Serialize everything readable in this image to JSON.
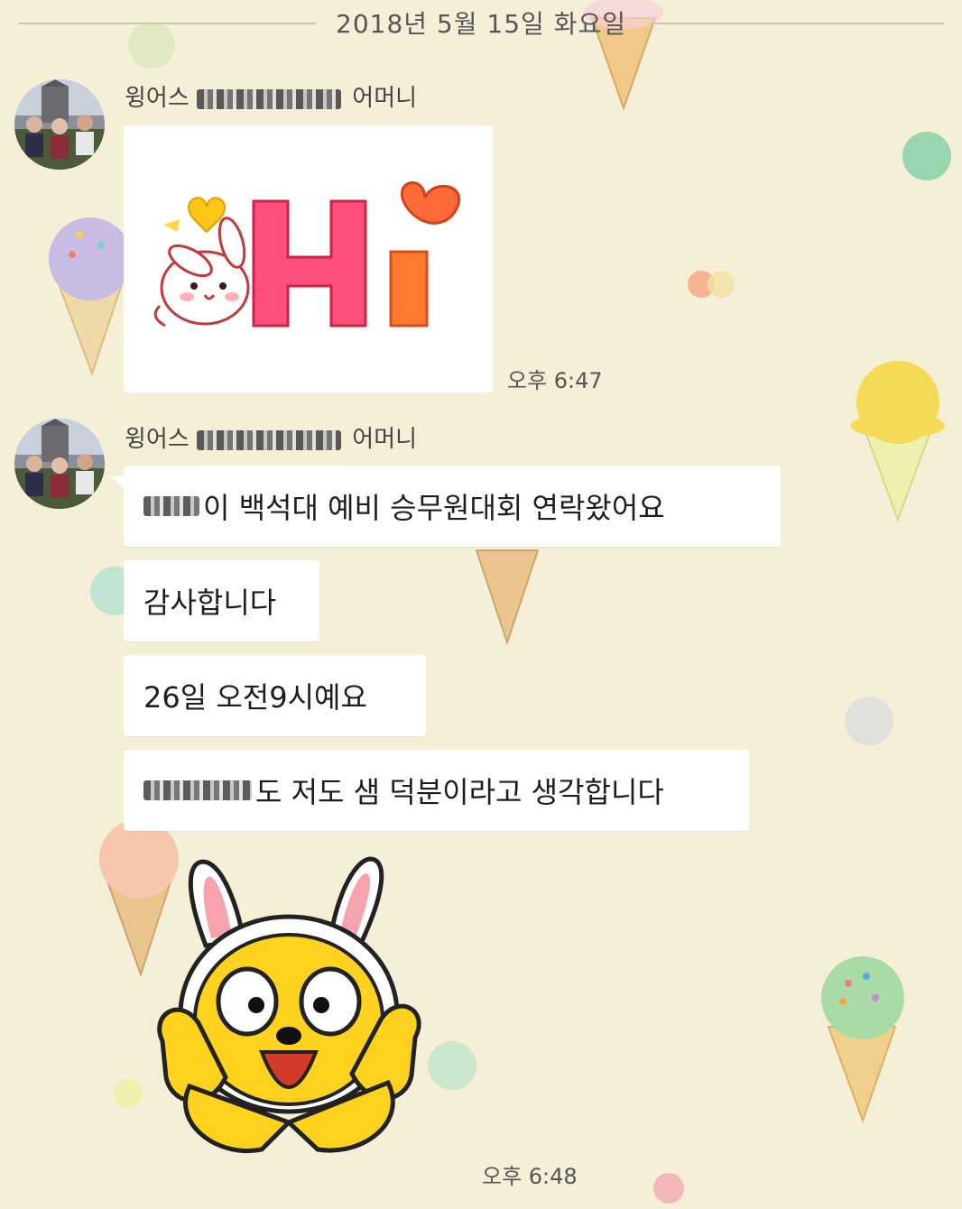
{
  "date_divider": "2018년 5월 15일 화요일",
  "messages": [
    {
      "sender_prefix": "윙어스",
      "sender_suffix": "어머니",
      "type": "sticker",
      "sticker_text": "Hi",
      "time": "오후 6:47"
    },
    {
      "sender_prefix": "윙어스",
      "sender_suffix": "어머니",
      "type": "text_group",
      "bubbles": [
        "이 백석대 예비 승무원대회 연락왔어요",
        "감사합니다",
        "26일 오전9시예요",
        "도 저도 샘 덕분이라고 생각합니다"
      ],
      "sticker": "rabbit-hood-character",
      "time": "오후 6:48"
    }
  ],
  "colors": {
    "background": "#f6efd8",
    "bubble": "#ffffff",
    "hi_pink": "#ff4f7a",
    "hi_orange": "#ff7a2e",
    "heart_yellow": "#ffc61a",
    "character_yellow": "#ffd21f"
  }
}
